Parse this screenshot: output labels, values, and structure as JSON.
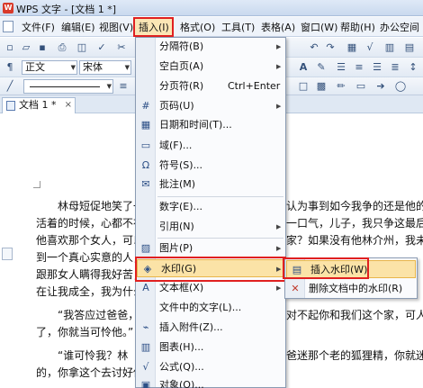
{
  "window": {
    "title": "WPS 文字 - [文档 1 *]"
  },
  "menubar": [
    {
      "label": "文件(F)"
    },
    {
      "label": "编辑(E)"
    },
    {
      "label": "视图(V)"
    },
    {
      "label": "插入(I)"
    },
    {
      "label": "格式(O)"
    },
    {
      "label": "工具(T)"
    },
    {
      "label": "表格(A)"
    },
    {
      "label": "窗口(W)"
    },
    {
      "label": "帮助(H)"
    },
    {
      "label": "办公空间"
    }
  ],
  "toolbar": {
    "style_value": "正文",
    "font_value": "宋体"
  },
  "tab": {
    "label": "文档 1 *"
  },
  "insert_menu": [
    {
      "label": "分隔符(B)",
      "submenu": true,
      "icon": "none"
    },
    {
      "label": "空白页(A)",
      "submenu": true,
      "icon": "none"
    },
    {
      "label": "分页符(R)",
      "shortcut": "Ctrl+Enter",
      "icon": "none"
    },
    {
      "label": "页码(U)",
      "submenu": true,
      "icon": "page-number-icon"
    },
    {
      "label": "日期和时间(T)...",
      "icon": "calendar-icon"
    },
    {
      "label": "域(F)...",
      "icon": "field-icon"
    },
    {
      "label": "符号(S)...",
      "icon": "omega-icon"
    },
    {
      "label": "批注(M)",
      "icon": "comment-icon"
    },
    {
      "label": "数字(E)...",
      "icon": "none"
    },
    {
      "label": "引用(N)",
      "submenu": true,
      "icon": "none"
    },
    {
      "label": "图片(P)",
      "submenu": true,
      "icon": "picture-icon"
    },
    {
      "label": "水印(G)",
      "submenu": true,
      "icon": "watermark-icon",
      "highlighted": true
    },
    {
      "label": "文本框(X)",
      "submenu": true,
      "icon": "textbox-icon"
    },
    {
      "label": "文件中的文字(L)...",
      "icon": "none"
    },
    {
      "label": "插入附件(Z)...",
      "icon": "attachment-icon"
    },
    {
      "label": "图表(H)...",
      "icon": "chart-icon"
    },
    {
      "label": "公式(Q)...",
      "icon": "formula-icon"
    },
    {
      "label": "对象(O)...",
      "icon": "object-icon"
    }
  ],
  "watermark_menu": [
    {
      "label": "插入水印(W)",
      "icon": "insert-watermark-icon",
      "highlighted": true
    },
    {
      "label": "删除文档中的水印(R)",
      "icon": "delete-watermark-icon"
    }
  ],
  "document": {
    "lines": [
      "　　林母短促地笑了一声，",
      "活着的时候，心都不在",
      "他喜欢那个女人，可以",
      "到一个真心实意的人，",
      "跟那女人瞒得我好苦，",
      "在让我成全，我为什么",
      "　　“我答应过爸爸，",
      "了，你就当可怜他。”",
      "　　“谁可怜我？林",
      "的，你拿这个去讨好他"
    ],
    "right_lines": [
      "认为事到如今我争的还是他的人吗",
      "一口气，儿子，我只争这最后一口",
      "家？如果没有他林介州，我未必",
      "妻子呢，难道就比不上他的值钱",
      "对不起你和我们这个家，可人已死",
      "爸迷那个老的狐狸精，你就迷那个"
    ]
  }
}
